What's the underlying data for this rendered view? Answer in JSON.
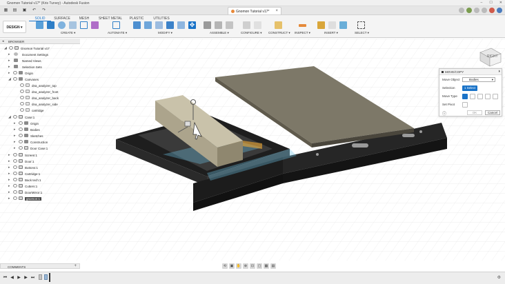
{
  "titlebar": {
    "title": "Gnomon Tutorial v17* (Kris Turvey) - Autodesk Fusion",
    "minimize": "–",
    "maximize": "☐",
    "close": "✕"
  },
  "doc_tab": {
    "label": "Gnomon Tutorial v17*",
    "close": "×"
  },
  "toolbar": {
    "design_label": "DESIGN ▾",
    "tabs": [
      "SOLID",
      "SURFACE",
      "MESH",
      "SHEET METAL",
      "PLASTIC",
      "UTILITIES"
    ],
    "groups": [
      "CREATE ▾",
      "AUTOMATE ▾",
      "MODIFY ▾",
      "ASSEMBLE ▾",
      "CONFIGURE ▾",
      "CONSTRUCT ▾",
      "INSPECT ▾",
      "INSERT ▾",
      "SELECT ▾"
    ]
  },
  "browser": {
    "title": "BROWSER",
    "items": [
      {
        "label": "Gnomon Tutorial v17"
      },
      {
        "label": "Document Settings"
      },
      {
        "label": "Named Views"
      },
      {
        "label": "Selection Sets"
      },
      {
        "label": "Origin"
      },
      {
        "label": "Canvases"
      },
      {
        "label": "dna_analyzer_top"
      },
      {
        "label": "dna_analyzer_front"
      },
      {
        "label": "dna_analyzer_back"
      },
      {
        "label": "dna_analyzer_side"
      },
      {
        "label": "cartridge"
      },
      {
        "label": "Case:1"
      },
      {
        "label": "Origin"
      },
      {
        "label": "Bodies"
      },
      {
        "label": "Sketches"
      },
      {
        "label": "Construction"
      },
      {
        "label": "Door Case:1"
      },
      {
        "label": "Screen:1"
      },
      {
        "label": "Door:1"
      },
      {
        "label": "Buttons:1"
      },
      {
        "label": "Cartridge:1"
      },
      {
        "label": "Back tech:1"
      },
      {
        "label": "Cutters:1"
      },
      {
        "label": "DoorMirror:1"
      },
      {
        "label": "gnomon:1"
      }
    ]
  },
  "panel": {
    "title": "MOVE/COPY",
    "move_object_label": "Move Object",
    "move_object_value": "Bodies",
    "selection_label": "Selection",
    "select_button": "1 Select",
    "move_type_label": "Move Type",
    "set_pivot_label": "Set Pivot",
    "ok": "OK",
    "cancel": "Cancel"
  },
  "comments": {
    "title": "COMMENTS"
  },
  "viewcube": {
    "face": "RIGHT"
  },
  "colors": {
    "accent": "#1a73c8",
    "part_dark": "#2b2b2b",
    "plate": "#7d7868",
    "highlight": "#6fc7e8"
  }
}
